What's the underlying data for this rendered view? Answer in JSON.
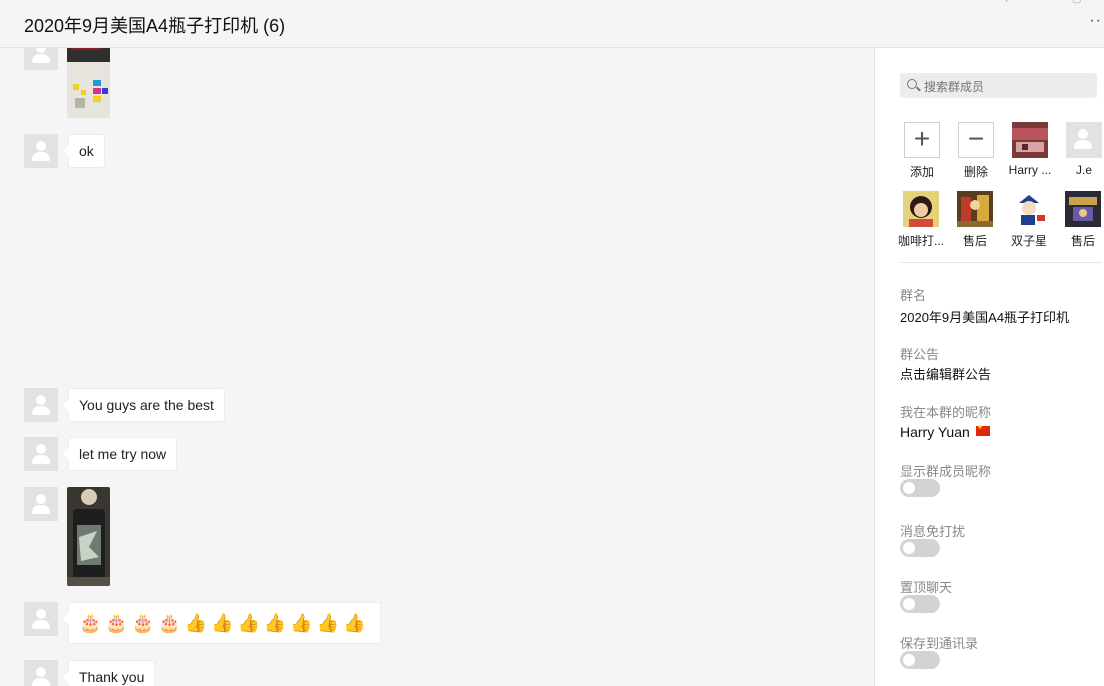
{
  "window": {
    "title": "2020年9月美国A4瓶子打印机 (6)",
    "more_icon": "more-dots-icon"
  },
  "chat": {
    "messages": [
      {
        "type": "image",
        "description_icon": "photo-thumbnail"
      },
      {
        "type": "text",
        "text": "ok"
      },
      {
        "type": "text",
        "text": "You guys are the best"
      },
      {
        "type": "text",
        "text": "let me try now"
      },
      {
        "type": "image",
        "description_icon": "photo-thumbnail"
      },
      {
        "type": "emoji",
        "text": "🎂🎂🎂🎂👍👍👍👍👍👍👍"
      },
      {
        "type": "text",
        "text": "Thank you"
      }
    ]
  },
  "panel": {
    "search": {
      "placeholder": "搜索群成员"
    },
    "members": [
      {
        "label": "添加",
        "icon": "plus-icon"
      },
      {
        "label": "删除",
        "icon": "minus-icon"
      },
      {
        "label": "Harry ...",
        "icon": "avatar-photo"
      },
      {
        "label": "J.e",
        "icon": "avatar-default"
      },
      {
        "label": "咖啡打...",
        "icon": "avatar-photo"
      },
      {
        "label": "售后",
        "icon": "avatar-photo"
      },
      {
        "label": "双子星",
        "icon": "avatar-photo"
      },
      {
        "label": "售后",
        "icon": "avatar-photo"
      }
    ],
    "group_name_label": "群名",
    "group_name_value": "2020年9月美国A4瓶子打印机",
    "announcement_label": "群公告",
    "announcement_value": "点击编辑群公告",
    "nickname_label": "我在本群的昵称",
    "nickname_value": "Harry Yuan",
    "toggles": [
      {
        "label": "显示群成员昵称",
        "on": false
      },
      {
        "label": "消息免打扰",
        "on": false
      },
      {
        "label": "置顶聊天",
        "on": false
      },
      {
        "label": "保存到通讯录",
        "on": false
      }
    ]
  },
  "colors": {
    "background": "#f5f5f5",
    "panel": "#ffffff",
    "toggle_off": "#d3d3d3",
    "flag_red": "#de2910"
  }
}
